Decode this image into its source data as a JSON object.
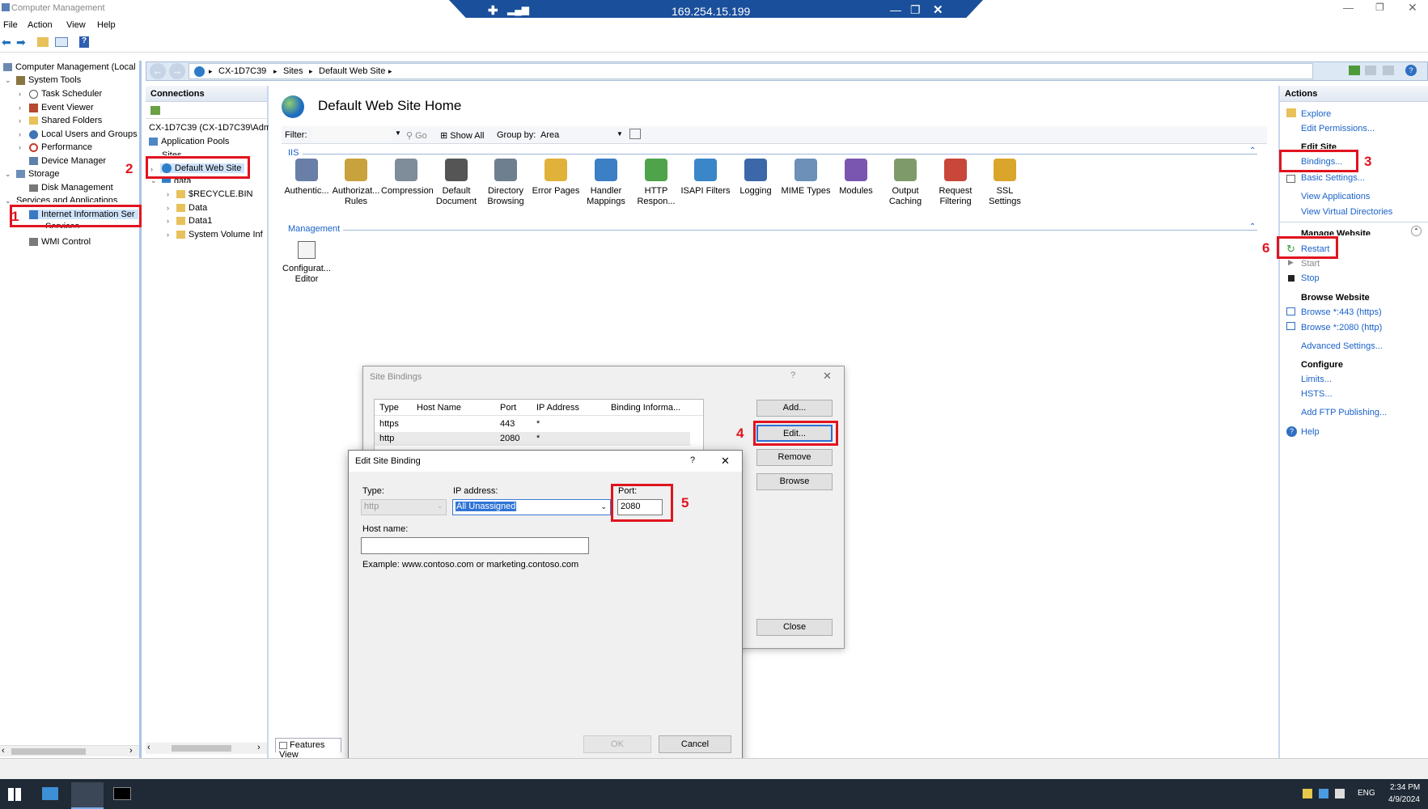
{
  "window": {
    "title": "Computer Management"
  },
  "rdp_bar": {
    "ip": "169.254.15.199"
  },
  "menu": [
    "File",
    "Action",
    "View",
    "Help"
  ],
  "tree": {
    "root": "Computer Management (Local",
    "system_tools": "System Tools",
    "task_scheduler": "Task Scheduler",
    "event_viewer": "Event Viewer",
    "shared_folders": "Shared Folders",
    "local_users": "Local Users and Groups",
    "performance": "Performance",
    "device_manager": "Device Manager",
    "storage": "Storage",
    "disk_management": "Disk Management",
    "services_apps": "Services and Applications",
    "iis": "Internet Information Ser",
    "services": "Services",
    "wmi": "WMI Control"
  },
  "breadcrumb": [
    "CX-1D7C39",
    "Sites",
    "Default Web Site"
  ],
  "connections": {
    "title": "Connections",
    "server": "CX-1D7C39 (CX-1D7C39\\Adm",
    "app_pools": "Application Pools",
    "sites": "Sites",
    "default_site": "Default Web Site",
    "data_root": "data",
    "recycle": "$RECYCLE.BIN",
    "data": "Data",
    "data1": "Data1",
    "svi": "System Volume Inf"
  },
  "center": {
    "title": "Default Web Site Home",
    "filter_label": "Filter:",
    "go": "Go",
    "show_all": "Show All",
    "group_by": "Group by:",
    "group_value": "Area",
    "iis_section": "IIS",
    "mgmt_section": "Management",
    "features": [
      {
        "l1": "Authentic...",
        "l2": ""
      },
      {
        "l1": "Authorizat...",
        "l2": "Rules"
      },
      {
        "l1": "Compression",
        "l2": ""
      },
      {
        "l1": "Default",
        "l2": "Document"
      },
      {
        "l1": "Directory",
        "l2": "Browsing"
      },
      {
        "l1": "Error Pages",
        "l2": ""
      },
      {
        "l1": "Handler",
        "l2": "Mappings"
      },
      {
        "l1": "HTTP",
        "l2": "Respon..."
      },
      {
        "l1": "ISAPI Filters",
        "l2": ""
      },
      {
        "l1": "Logging",
        "l2": ""
      },
      {
        "l1": "MIME Types",
        "l2": ""
      },
      {
        "l1": "Modules",
        "l2": ""
      },
      {
        "l1": "Output",
        "l2": "Caching"
      },
      {
        "l1": "Request",
        "l2": "Filtering"
      },
      {
        "l1": "SSL Settings",
        "l2": ""
      }
    ],
    "config_editor": {
      "l1": "Configurat...",
      "l2": "Editor"
    },
    "features_view": "Features View"
  },
  "actions": {
    "title": "Actions",
    "explore": "Explore",
    "edit_permissions": "Edit Permissions...",
    "edit_site": "Edit Site",
    "bindings": "Bindings...",
    "basic_settings": "Basic Settings...",
    "view_apps": "View Applications",
    "view_vdirs": "View Virtual Directories",
    "manage_website": "Manage Website",
    "restart": "Restart",
    "start": "Start",
    "stop": "Stop",
    "browse_website": "Browse Website",
    "browse_443": "Browse *:443 (https)",
    "browse_2080": "Browse *:2080 (http)",
    "advanced": "Advanced Settings...",
    "configure": "Configure",
    "limits": "Limits...",
    "hsts": "HSTS...",
    "ftp": "Add FTP Publishing...",
    "help": "Help"
  },
  "site_bindings": {
    "title": "Site Bindings",
    "headers": [
      "Type",
      "Host Name",
      "Port",
      "IP Address",
      "Binding Informa..."
    ],
    "rows": [
      [
        "https",
        "",
        "443",
        "*",
        ""
      ],
      [
        "http",
        "",
        "2080",
        "*",
        ""
      ]
    ],
    "add": "Add...",
    "edit": "Edit...",
    "remove": "Remove",
    "browse": "Browse",
    "close": "Close"
  },
  "edit_binding": {
    "title": "Edit Site Binding",
    "type_label": "Type:",
    "type_value": "http",
    "ip_label": "IP address:",
    "ip_value": "All Unassigned",
    "port_label": "Port:",
    "port_value": "2080",
    "host_label": "Host name:",
    "host_value": "",
    "example": "Example: www.contoso.com or marketing.contoso.com",
    "ok": "OK",
    "cancel": "Cancel"
  },
  "steps": [
    "1",
    "2",
    "3",
    "4",
    "5",
    "6"
  ],
  "taskbar": {
    "lang": "ENG",
    "time": "2:34 PM",
    "date": "4/9/2024"
  },
  "colors": {
    "annotation": "#e0141e",
    "link": "#1a62c9",
    "taskbar": "#1f2a36"
  }
}
